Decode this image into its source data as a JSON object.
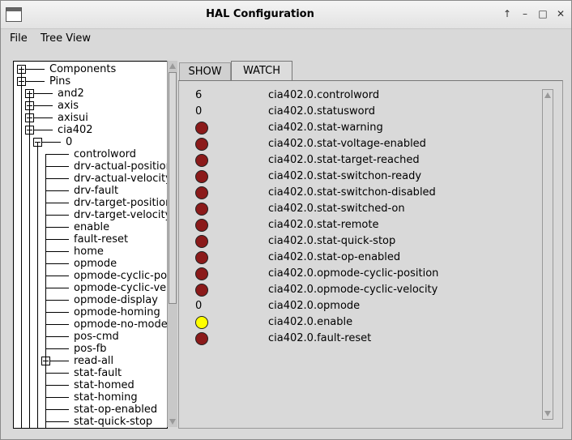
{
  "window": {
    "title": "HAL Configuration",
    "controls": [
      "↑",
      "–",
      "□",
      "✕"
    ]
  },
  "menu": {
    "file": "File",
    "tree_view": "Tree View"
  },
  "tree": {
    "rows": [
      {
        "label": "Components",
        "depth": 0,
        "expander": "plus"
      },
      {
        "label": "Pins",
        "depth": 0,
        "expander": "minus"
      },
      {
        "label": "and2",
        "depth": 1,
        "expander": "plus"
      },
      {
        "label": "axis",
        "depth": 1,
        "expander": "plus"
      },
      {
        "label": "axisui",
        "depth": 1,
        "expander": "plus"
      },
      {
        "label": "cia402",
        "depth": 1,
        "expander": "minus"
      },
      {
        "label": "0",
        "depth": 2,
        "expander": "minus"
      },
      {
        "label": "controlword",
        "depth": 3,
        "expander": ""
      },
      {
        "label": "drv-actual-position",
        "depth": 3,
        "expander": ""
      },
      {
        "label": "drv-actual-velocity",
        "depth": 3,
        "expander": ""
      },
      {
        "label": "drv-fault",
        "depth": 3,
        "expander": ""
      },
      {
        "label": "drv-target-position",
        "depth": 3,
        "expander": ""
      },
      {
        "label": "drv-target-velocity",
        "depth": 3,
        "expander": ""
      },
      {
        "label": "enable",
        "depth": 3,
        "expander": ""
      },
      {
        "label": "fault-reset",
        "depth": 3,
        "expander": ""
      },
      {
        "label": "home",
        "depth": 3,
        "expander": ""
      },
      {
        "label": "opmode",
        "depth": 3,
        "expander": ""
      },
      {
        "label": "opmode-cyclic-position",
        "depth": 3,
        "expander": ""
      },
      {
        "label": "opmode-cyclic-velocity",
        "depth": 3,
        "expander": ""
      },
      {
        "label": "opmode-display",
        "depth": 3,
        "expander": ""
      },
      {
        "label": "opmode-homing",
        "depth": 3,
        "expander": ""
      },
      {
        "label": "opmode-no-mode",
        "depth": 3,
        "expander": ""
      },
      {
        "label": "pos-cmd",
        "depth": 3,
        "expander": ""
      },
      {
        "label": "pos-fb",
        "depth": 3,
        "expander": ""
      },
      {
        "label": "read-all",
        "depth": 3,
        "expander": "plus"
      },
      {
        "label": "stat-fault",
        "depth": 3,
        "expander": ""
      },
      {
        "label": "stat-homed",
        "depth": 3,
        "expander": ""
      },
      {
        "label": "stat-homing",
        "depth": 3,
        "expander": ""
      },
      {
        "label": "stat-op-enabled",
        "depth": 3,
        "expander": ""
      },
      {
        "label": "stat-quick-stop",
        "depth": 3,
        "expander": ""
      }
    ]
  },
  "tabs": {
    "show": "SHOW",
    "watch": "WATCH"
  },
  "colors": {
    "led_off": "#8b1a1a",
    "led_on": "#ffff00"
  },
  "watch": [
    {
      "kind": "value",
      "value": "6",
      "name": "cia402.0.controlword"
    },
    {
      "kind": "value",
      "value": "0",
      "name": "cia402.0.statusword"
    },
    {
      "kind": "led",
      "state": "off",
      "name": "cia402.0.stat-warning"
    },
    {
      "kind": "led",
      "state": "off",
      "name": "cia402.0.stat-voltage-enabled"
    },
    {
      "kind": "led",
      "state": "off",
      "name": "cia402.0.stat-target-reached"
    },
    {
      "kind": "led",
      "state": "off",
      "name": "cia402.0.stat-switchon-ready"
    },
    {
      "kind": "led",
      "state": "off",
      "name": "cia402.0.stat-switchon-disabled"
    },
    {
      "kind": "led",
      "state": "off",
      "name": "cia402.0.stat-switched-on"
    },
    {
      "kind": "led",
      "state": "off",
      "name": "cia402.0.stat-remote"
    },
    {
      "kind": "led",
      "state": "off",
      "name": "cia402.0.stat-quick-stop"
    },
    {
      "kind": "led",
      "state": "off",
      "name": "cia402.0.stat-op-enabled"
    },
    {
      "kind": "led",
      "state": "off",
      "name": "cia402.0.opmode-cyclic-position"
    },
    {
      "kind": "led",
      "state": "off",
      "name": "cia402.0.opmode-cyclic-velocity"
    },
    {
      "kind": "value",
      "value": "0",
      "name": "cia402.0.opmode"
    },
    {
      "kind": "led",
      "state": "on",
      "name": "cia402.0.enable"
    },
    {
      "kind": "led",
      "state": "off",
      "name": "cia402.0.fault-reset"
    }
  ]
}
